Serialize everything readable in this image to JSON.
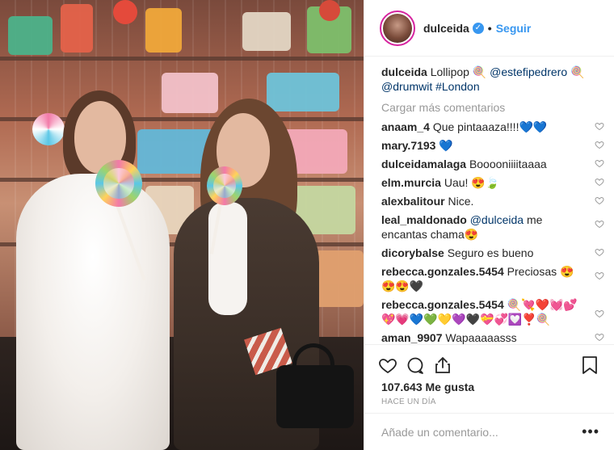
{
  "header": {
    "username": "dulceida",
    "verified_icon": "verified-badge-icon",
    "separator": "•",
    "follow_label": "Seguir"
  },
  "caption": {
    "username": "dulceida",
    "text_1": "Lollipop 🍭 ",
    "mention_1": "@estefipedrero",
    "text_2": " 🍭 ",
    "mention_2": "@drumwit",
    "text_3": " ",
    "hashtag": "#London"
  },
  "load_more_label": "Cargar más comentarios",
  "comments": [
    {
      "username": "anaam_4",
      "text": "Que pintaaaza!!!!💙💙"
    },
    {
      "username": "mary.7193",
      "text": "💙"
    },
    {
      "username": "dulceidamalaga",
      "text": "Booooniiiitaaaa"
    },
    {
      "username": "elm.murcia",
      "text": "Uau! 😍🍃"
    },
    {
      "username": "alexbalitour",
      "text": "Nice."
    },
    {
      "username": "leal_maldonado",
      "mention": "@dulceida",
      "text": " me encantas chama😍"
    },
    {
      "username": "dicorybalse",
      "text": "Seguro es bueno"
    },
    {
      "username": "rebecca.gonzales.5454",
      "text": "Preciosas 😍😍😍🖤"
    },
    {
      "username": "rebecca.gonzales.5454",
      "text": "🍭💘❤️💓💕💖💗💙💚💛💜🖤💝💞💟❣️🍭"
    },
    {
      "username": "aman_9907",
      "text": "Wapaaaaasss"
    }
  ],
  "actions": {
    "like_icon": "heart-icon",
    "comment_icon": "comment-icon",
    "share_icon": "share-icon",
    "save_icon": "bookmark-icon"
  },
  "likes": "107.643 Me gusta",
  "timestamp": "HACE UN DÍA",
  "add_comment": {
    "placeholder": "Añade un comentario...",
    "more": "•••"
  },
  "colors": {
    "link": "#003569",
    "follow": "#3897f0",
    "muted": "#999999",
    "border": "#efefef"
  }
}
